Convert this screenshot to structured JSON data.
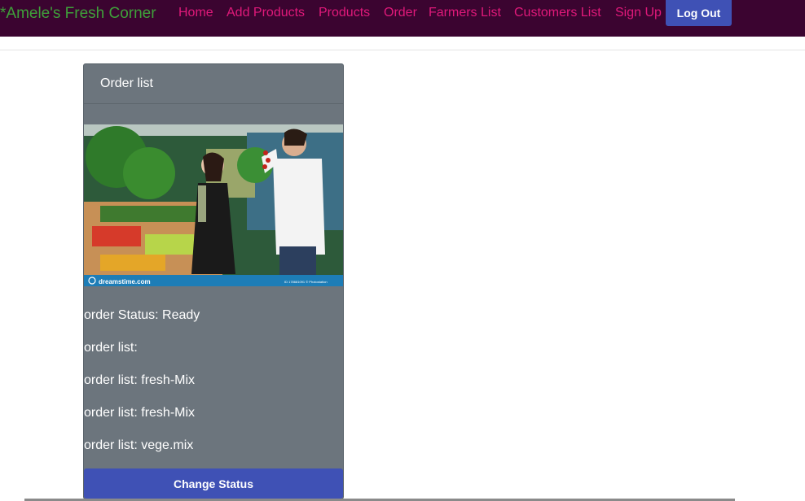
{
  "nav": {
    "brand": "*Amele's Fresh Corner",
    "links": [
      "Home",
      "Add Products",
      "Products",
      "Order",
      "Farmers List",
      "Customers List",
      "Sign Up"
    ],
    "logout": "Log Out"
  },
  "card": {
    "title": "Order list",
    "image_watermark": "dreamstime.com",
    "image_id": "ID 178681091 © Photostation",
    "status": "order Status: Ready",
    "items": [
      "order list:",
      "order list: fresh-Mix",
      "order list: fresh-Mix",
      "order list: vege.mix"
    ],
    "button": "Change Status"
  },
  "colors": {
    "navbar": "#3b0430",
    "brand": "#3fa03a",
    "link": "#e0197a",
    "button": "#3f51b5",
    "card": "#6c757d"
  }
}
